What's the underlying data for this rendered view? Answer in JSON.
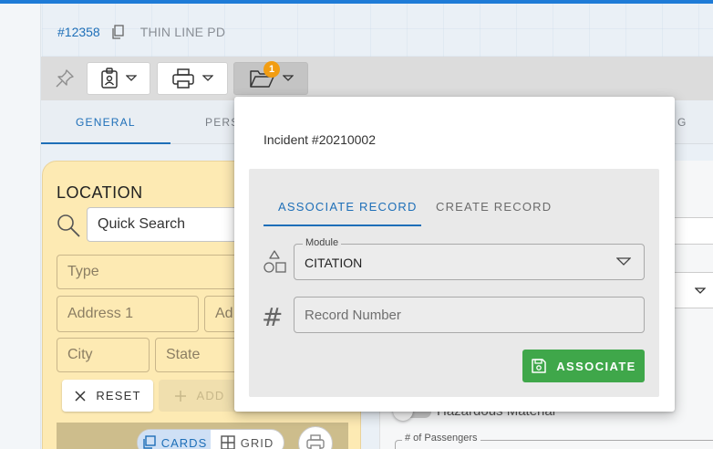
{
  "header": {
    "record_number": "#12358",
    "title": "THIN LINE PD"
  },
  "toolbar": {
    "badge_count": "1",
    "icons": [
      "pin-icon",
      "id-badge-icon",
      "print-icon",
      "folder-open-icon"
    ]
  },
  "tabs": [
    {
      "label": "GENERAL",
      "active": true
    },
    {
      "label": "PERS",
      "active": false
    },
    {
      "label": "G",
      "active": false
    }
  ],
  "location": {
    "title": "LOCATION",
    "quick_search_placeholder": "Quick Search",
    "type_placeholder": "Type",
    "address1_placeholder": "Address 1",
    "address2_placeholder": "Ad",
    "city_placeholder": "City",
    "state_placeholder": "State",
    "reset_label": "RESET",
    "add_label": "ADD",
    "view_cards_label": "CARDS",
    "view_grid_label": "GRID"
  },
  "right_panel": {
    "hazard_label": "Hazardous Material",
    "passengers_label": "# of Passengers"
  },
  "popover": {
    "title": "Incident #20210002",
    "tabs": [
      {
        "label": "ASSOCIATE RECORD",
        "active": true
      },
      {
        "label": "CREATE RECORD",
        "active": false
      }
    ],
    "module_label": "Module",
    "module_value": "CITATION",
    "record_number_placeholder": "Record Number",
    "associate_label": "ASSOCIATE"
  },
  "colors": {
    "accent": "#1e6fb8",
    "badge": "#f29d12",
    "associate_button": "#3fa74a",
    "location_card": "#fdeab3"
  }
}
